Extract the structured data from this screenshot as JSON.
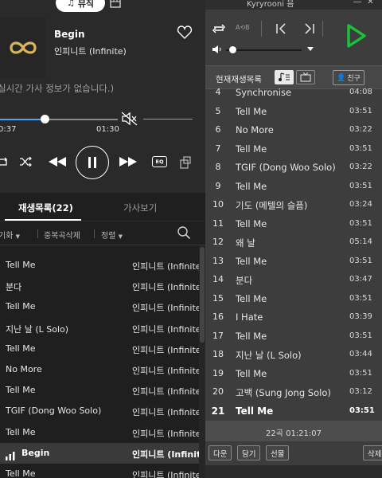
{
  "left": {
    "music_tab": "뮤직",
    "song": {
      "title": "Begin",
      "artist": "인피니트 (Infinite)"
    },
    "no_lyrics": "실시간 가사 정보가 없습니다.)",
    "time_current": "0:37",
    "time_total": "01:30",
    "progress": 0.25,
    "eq_label": "EQ",
    "tabs": {
      "playlist": "재생목록(22)",
      "lyrics": "가사보기"
    },
    "sort_bar": {
      "item1": "기화",
      "item2": "중복곡삭제",
      "item3": "정렬"
    },
    "playlist": [
      {
        "title": "Tell Me",
        "artist": "인피니트 (Infinite)"
      },
      {
        "title": "분다",
        "artist": "인피니트 (Infinite)"
      },
      {
        "title": "Tell Me",
        "artist": "인피니트 (Infinite)"
      },
      {
        "title": "지난 날 (L Solo)",
        "artist": "인피니트 (Infinite)"
      },
      {
        "title": "Tell Me",
        "artist": "인피니트 (Infinite)"
      },
      {
        "title": "No More",
        "artist": "인피니트 (Infinite)"
      },
      {
        "title": "Tell Me",
        "artist": "인피니트 (Infinite)"
      },
      {
        "title": "TGIF (Dong Woo Solo)",
        "artist": "인피니트 (Infinite)"
      },
      {
        "title": "Tell Me",
        "artist": "인피니트 (Infinite)"
      },
      {
        "title": "Begin",
        "artist": "인피니트 (Infinite)",
        "active": true
      },
      {
        "title": "Tell Me",
        "artist": "인피니트 (Infinite)"
      }
    ],
    "colors": {
      "accent": "#4ba3ff",
      "panel": "#1f1f1f"
    }
  },
  "right": {
    "window_title": "Kyryrooni 음",
    "ab_label": "A⟲B",
    "header": {
      "label": "현재재생목록",
      "friend": "친구"
    },
    "tracks": [
      {
        "no": "4",
        "title": "Synchronise",
        "duration": "04:08"
      },
      {
        "no": "5",
        "title": "Tell Me",
        "duration": "03:51"
      },
      {
        "no": "6",
        "title": "No More",
        "duration": "03:22"
      },
      {
        "no": "7",
        "title": "Tell Me",
        "duration": "03:51"
      },
      {
        "no": "8",
        "title": "TGIF (Dong Woo Solo)",
        "duration": "03:22"
      },
      {
        "no": "9",
        "title": "Tell Me",
        "duration": "03:51"
      },
      {
        "no": "10",
        "title": "기도 (메텔의 슬픔)",
        "duration": "03:24"
      },
      {
        "no": "11",
        "title": "Tell Me",
        "duration": "03:51"
      },
      {
        "no": "12",
        "title": "왜 날",
        "duration": "05:14"
      },
      {
        "no": "13",
        "title": "Tell Me",
        "duration": "03:51"
      },
      {
        "no": "14",
        "title": "분다",
        "duration": "03:47"
      },
      {
        "no": "15",
        "title": "Tell Me",
        "duration": "03:51"
      },
      {
        "no": "16",
        "title": "I Hate",
        "duration": "03:39"
      },
      {
        "no": "17",
        "title": "Tell Me",
        "duration": "03:51"
      },
      {
        "no": "18",
        "title": "지난 날 (L Solo)",
        "duration": "03:44"
      },
      {
        "no": "19",
        "title": "Tell Me",
        "duration": "03:51"
      },
      {
        "no": "20",
        "title": "고백 (Sung Jong Solo)",
        "duration": "03:12"
      },
      {
        "no": "21",
        "title": "Tell Me",
        "duration": "03:51",
        "current": true
      }
    ],
    "footer_count": "22곡 01:21:07",
    "buttons": {
      "download": "다운",
      "add": "담기",
      "gift": "선물",
      "delete": "삭제"
    },
    "colors": {
      "play": "#19c23a",
      "panel": "#3d3d3d"
    }
  }
}
